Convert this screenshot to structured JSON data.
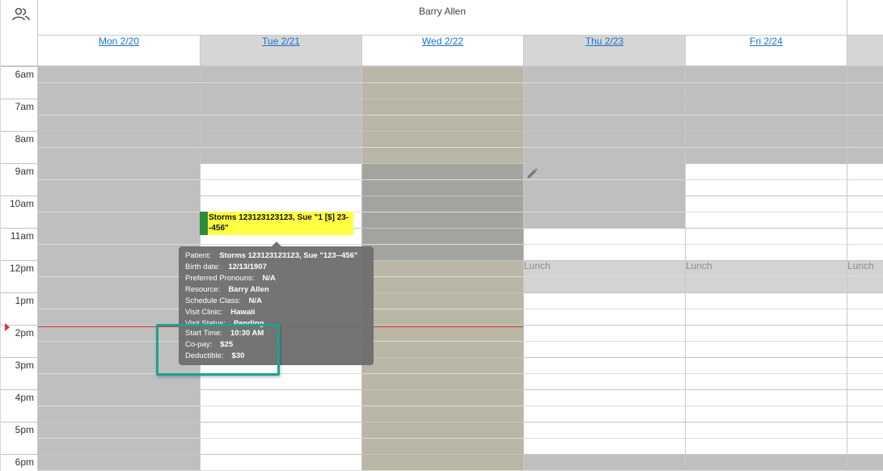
{
  "header": {
    "resource_icon": "people-icon",
    "resource_name": "Barry Allen"
  },
  "days": [
    {
      "label": "Mon 2/20"
    },
    {
      "label": "Tue 2/21"
    },
    {
      "label": "Wed 2/22"
    },
    {
      "label": "Thu 2/23"
    },
    {
      "label": "Fri 2/24"
    }
  ],
  "times": [
    "6am",
    "7am",
    "8am",
    "9am",
    "10am",
    "11am",
    "12pm",
    "1pm",
    "2pm",
    "3pm",
    "4pm",
    "5pm",
    "6pm"
  ],
  "lunch_label": "Lunch",
  "edit_icon": "pencil-icon",
  "appointment": {
    "title": "Storms 123123123123, Sue \"1 [$] 23--456\""
  },
  "tooltip": {
    "rows": [
      {
        "key": "Patient:",
        "value": "Storms 123123123123, Sue \"123--456\""
      },
      {
        "key": "Birth date:",
        "value": "12/13/1907"
      },
      {
        "key": "Preferred Pronouns:",
        "value": "N/A"
      },
      {
        "key": "Resource:",
        "value": "Barry Allen"
      },
      {
        "key": "Schedule Class:",
        "value": "N/A"
      },
      {
        "key": "Visit Clinic:",
        "value": "Hawaii"
      },
      {
        "key": "Visit Status:",
        "value": "Pending"
      }
    ],
    "highlighted_rows": [
      {
        "key": "Start Time:",
        "value": "10:30 AM"
      },
      {
        "key": "Co-pay:",
        "value": "$25"
      },
      {
        "key": "Deductible:",
        "value": "$30"
      }
    ]
  },
  "colors": {
    "unavailable": "#bfbfbf",
    "blocked": "#b9b6a8",
    "blocked_dark": "#9f9f9b",
    "appointment": "#ffff44",
    "appointment_stripe": "#2e8b3e",
    "highlight": "#1aa590",
    "now_line": "#e03030"
  }
}
